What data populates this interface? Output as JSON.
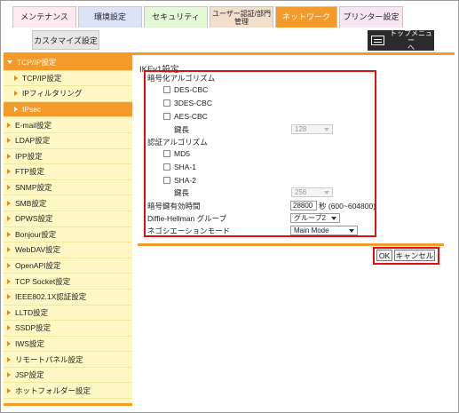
{
  "tabs": {
    "maintenance": "メンテナンス",
    "environment": "環境設定",
    "security": "セキュリティ",
    "user_auth_line1": "ユーザー認証/部門",
    "user_auth_line2": "管理",
    "network": "ネットワーク",
    "printer": "プリンター設定",
    "customize": "カスタマイズ設定",
    "top_menu_line1": "トップメニュー",
    "top_menu_line2": "へ"
  },
  "sidebar": {
    "group": "TCP/IP設定",
    "subitems": [
      "TCP/IP設定",
      "IPフィルタリング",
      "IPsec"
    ],
    "items": [
      "E-mail設定",
      "LDAP設定",
      "IPP設定",
      "FTP設定",
      "SNMP設定",
      "SMB設定",
      "DPWS設定",
      "Bonjour設定",
      "WebDAV設定",
      "OpenAPI設定",
      "TCP Socket設定",
      "IEEE802.1X認証設定",
      "LLTD設定",
      "SSDP設定",
      "IWS設定",
      "リモートパネル設定",
      "JSP設定",
      "ホットフォルダー設定"
    ]
  },
  "form": {
    "title": "IKEv1設定",
    "enc_label": "暗号化アルゴリズム",
    "enc_options": [
      "DES-CBC",
      "3DES-CBC",
      "AES-CBC"
    ],
    "key_length_label": "鍵長",
    "enc_key_length": "128",
    "auth_label": "認証アルゴリズム",
    "auth_options": [
      "MD5",
      "SHA-1",
      "SHA-2"
    ],
    "auth_key_length": "256",
    "lifetime_label": "暗号鍵有効時間",
    "lifetime_value": "28800",
    "lifetime_unit": "秒 (600~604800)",
    "dh_label": "Diffie-Hellman グループ",
    "dh_value": "グループ2",
    "nego_label": "ネゴシエーションモード",
    "nego_value": "Main Mode"
  },
  "buttons": {
    "ok": "OK",
    "cancel": "キャンセル"
  },
  "colors": {
    "accent": "#f49a2a",
    "highlight_box": "#dd1111",
    "sidebar_bg": "#fff8c4"
  }
}
